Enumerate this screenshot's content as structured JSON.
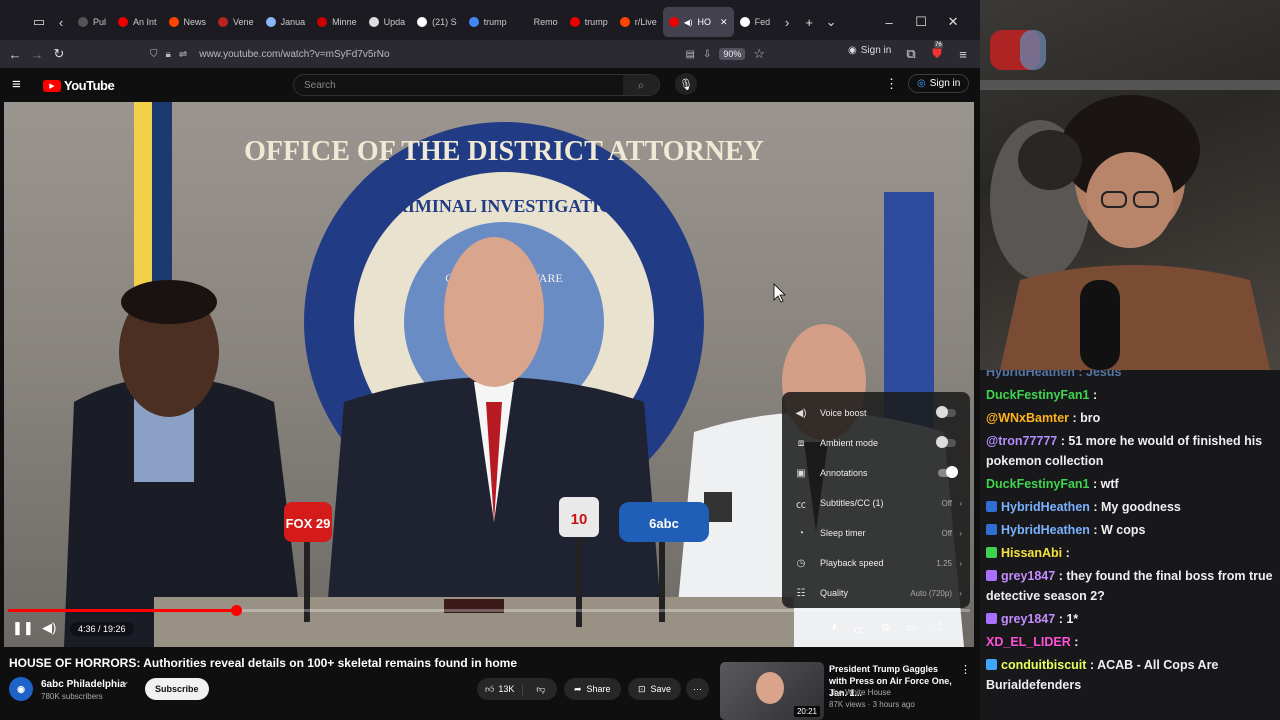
{
  "browser": {
    "tabs": [
      "Pul",
      "An Int",
      "News",
      "Vene",
      "Janua",
      "Minne",
      "Upda",
      "(21) S",
      "trump",
      "Remo",
      "trump",
      "r/Live",
      "HO",
      "Fed"
    ],
    "url": "www.youtube.com/watch?v=mSyFd7v5rNo",
    "zoom": "90%",
    "signin": "Sign in",
    "badge_count": "76"
  },
  "youtube": {
    "logo": "YouTube",
    "search_placeholder": "Search",
    "signin": "Sign in"
  },
  "video_scene": {
    "seal_text": "OFFICE OF THE DISTRICT ATTORNEY",
    "seal_inner": "CRIMINAL INVESTIGATION",
    "seal_county": "COUNTY DELAWARE",
    "mic_fox": "FOX 29",
    "mic_10": "10",
    "mic_6": "6abc"
  },
  "player": {
    "time": "4:36 / 19:26",
    "progress": 0.237
  },
  "settings": [
    {
      "icon": "voice-boost-icon",
      "label": "Voice boost",
      "value": "",
      "type": "toggle",
      "on": false
    },
    {
      "icon": "ambient-icon",
      "label": "Ambient mode",
      "value": "",
      "type": "toggle",
      "on": false
    },
    {
      "icon": "annotations-icon",
      "label": "Annotations",
      "value": "",
      "type": "toggle",
      "on": true
    },
    {
      "icon": "cc-icon",
      "label": "Subtitles/CC (1)",
      "value": "Off",
      "type": "menu"
    },
    {
      "icon": "sleep-icon",
      "label": "Sleep timer",
      "value": "Off",
      "type": "menu"
    },
    {
      "icon": "speed-icon",
      "label": "Playback speed",
      "value": "1.25",
      "type": "menu"
    },
    {
      "icon": "quality-icon",
      "label": "Quality",
      "value": "Auto (720p)",
      "type": "menu"
    }
  ],
  "video_info": {
    "title": "HOUSE OF HORRORS: Authorities reveal details on 100+ skeletal remains found in home",
    "channel": "6abc Philadelphia",
    "subscribers": "780K subscribers",
    "subscribe": "Subscribe",
    "likes": "13K",
    "share": "Share",
    "save": "Save"
  },
  "related": {
    "title": "President Trump Gaggles with Press on Air Force One, Jan. 1...",
    "channel": "The White House",
    "meta": "87K views · 3 hours ago",
    "duration": "20:21"
  },
  "chat": [
    {
      "user": "DuckFestinyFan1",
      "color": "#3fd44e",
      "text": "",
      "badge": ""
    },
    {
      "user": "@WNxBamter",
      "color": "#ffb31a",
      "text": "bro",
      "badge": ""
    },
    {
      "user": "@tron77777",
      "color": "#b48dff",
      "text": "51 more he would of finished his pokemon collection",
      "badge": ""
    },
    {
      "user": "DuckFestinyFan1",
      "color": "#3fd44e",
      "text": "wtf",
      "badge": ""
    },
    {
      "user": "HybridHeathen",
      "color": "#7ab2ff",
      "text": "My goodness",
      "badge": "#2f6fd1"
    },
    {
      "user": "HybridHeathen",
      "color": "#7ab2ff",
      "text": "W cops",
      "badge": "#2f6fd1"
    },
    {
      "user": "HissanAbi",
      "color": "#f4e23c",
      "text": "",
      "badge": "#3fd44e"
    },
    {
      "user": "grey1847",
      "color": "#c58cff",
      "text": "they found the final boss from true detective season 2?",
      "badge": "#a970ff"
    },
    {
      "user": "grey1847",
      "color": "#c58cff",
      "text": "1*",
      "badge": "#a970ff"
    },
    {
      "user": "XD_EL_LIDER",
      "color": "#ff4fd8",
      "text": "",
      "badge": ""
    },
    {
      "user": "conduitbiscuit",
      "color": "#eaff5c",
      "text": "ACAB - All Cops Are Burialdefenders",
      "badge": "#3ea6ff"
    }
  ],
  "chat_partial_top": "HybridHeathen : Jesus"
}
